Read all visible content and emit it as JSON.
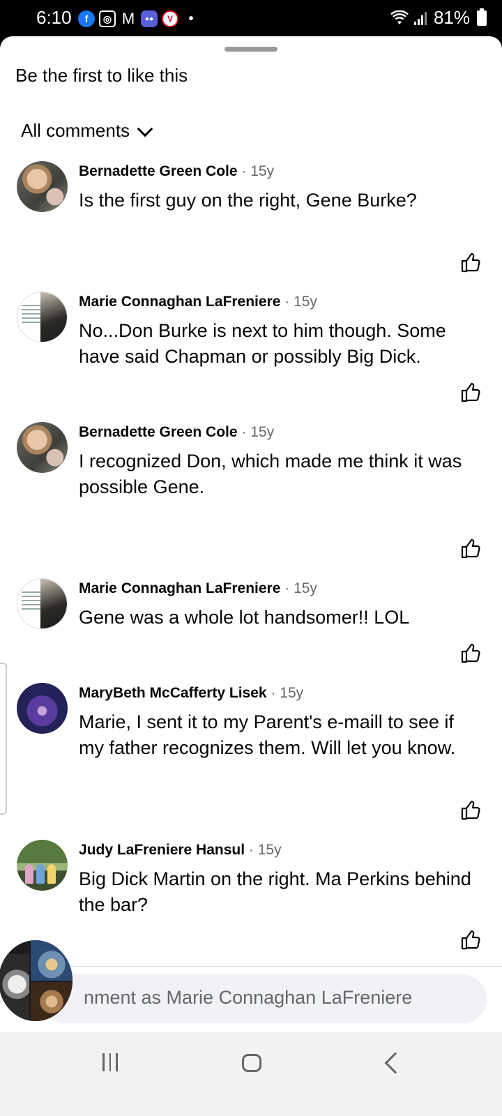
{
  "status_bar": {
    "time": "6:10",
    "battery": "81%",
    "notification_icons": [
      "facebook-icon",
      "instagram-icon",
      "gmail-icon",
      "chat-icon",
      "vivaldi-icon",
      "dot-icon"
    ]
  },
  "sheet": {
    "likes_text": "Be the first to like this",
    "filter_label": "All comments"
  },
  "comments": [
    {
      "author": "Bernadette Green Cole",
      "time": "15y",
      "text": "Is the first guy on the right, Gene Burke?",
      "avatar": "bernadette-avatar"
    },
    {
      "author": "Marie Connaghan LaFreniere",
      "time": "15y",
      "text": "No...Don Burke is next to him though. Some have said Chapman or possibly Big Dick.",
      "avatar": "marie-avatar"
    },
    {
      "author": "Bernadette Green Cole",
      "time": "15y",
      "text": "I recognized Don, which made me think it was possible Gene.",
      "avatar": "bernadette-avatar"
    },
    {
      "author": "Marie Connaghan LaFreniere",
      "time": "15y",
      "text": "Gene was a whole lot handsomer!! LOL",
      "avatar": "marie-avatar"
    },
    {
      "author": "MaryBeth McCafferty Lisek",
      "time": "15y",
      "text": "Marie, I sent it to my Parent's e-maill to see if my father recognizes them.  Will let you know.",
      "avatar": "marybeth-avatar"
    },
    {
      "author": "Judy LaFreniere Hansul",
      "time": "15y",
      "text": "Big Dick Martin on the right. Ma Perkins behind the bar?",
      "avatar": "judy-avatar"
    }
  ],
  "composer": {
    "placeholder": "nment as Marie Connaghan LaFreniere"
  },
  "colors": {
    "text": "#050505",
    "secondary": "#65676b",
    "composer_bg": "#f0f2f5",
    "facebook_blue": "#1877f2"
  }
}
